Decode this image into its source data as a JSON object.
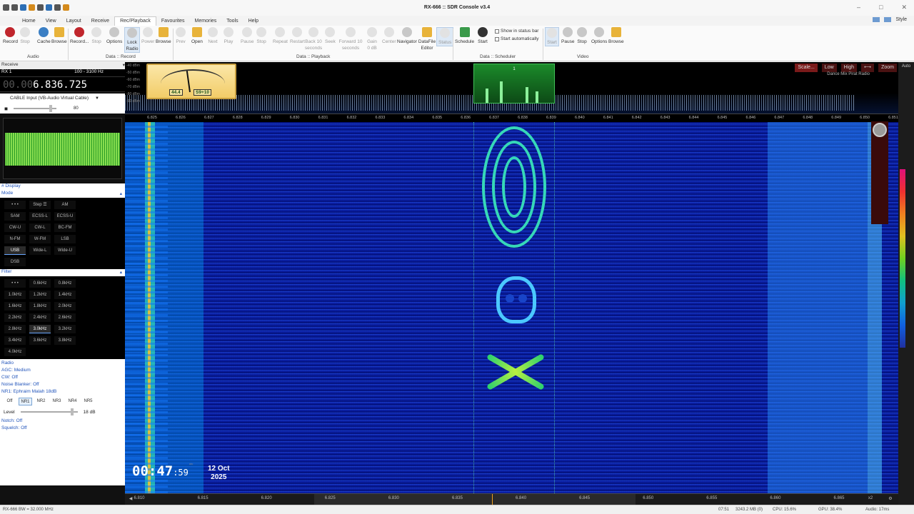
{
  "app": {
    "title": "RX-666 :: SDR Console v3.4",
    "style_label": "Style"
  },
  "menu": [
    "Home",
    "View",
    "Layout",
    "Receive",
    "Rec/Playback",
    "Favourites",
    "Memories",
    "Tools",
    "Help"
  ],
  "menu_active": "Rec/Playback",
  "ribbon": {
    "audio": {
      "group": "Audio",
      "buttons": [
        "Record",
        "Stop",
        "Cache",
        "Browse"
      ]
    },
    "data_record": {
      "group": "Data :: Record",
      "buttons": [
        "Record...",
        "Stop",
        "Options",
        "Lock Radio",
        "Power",
        "Browse"
      ]
    },
    "data_playback": {
      "group": "Data :: Playback",
      "buttons": [
        "Prev",
        "Open",
        "Next",
        "Play",
        "Pause",
        "Stop",
        "Repeat",
        "Restart",
        "Back 10 seconds",
        "Seek",
        "Forward 10 seconds",
        "Gain 0 dB",
        "Center",
        "Navigator",
        "DataFile Editor",
        "Status"
      ]
    },
    "data_scheduler": {
      "group": "Data :: Scheduler",
      "buttons": [
        "Schedule",
        "Start"
      ],
      "checks": [
        "Show in status bar",
        "Start automatically"
      ]
    },
    "video": {
      "group": "Video",
      "buttons": [
        "Start",
        "Pause",
        "Stop",
        "Options",
        "Browse"
      ]
    }
  },
  "left": {
    "receive_header": "Receive",
    "rx_label": "RX 1",
    "bandwidth": "100 - 3100 Hz",
    "freq_dim": "00.00",
    "freq_main": "6.836.725",
    "input_device": "CABLE Input (VB-Audio Virtual Cable)",
    "volume_value": "80",
    "display_label": "# Display",
    "mode_label": "Mode",
    "modes": [
      "• • •",
      "Step ☰",
      "AM",
      "SAM",
      "ECSS-L",
      "ECSS-U",
      "CW-U",
      "CW-L",
      "BC-FM",
      "N-FM",
      "W-FM",
      "LSB",
      "USB",
      "Wide-L",
      "Wide-U",
      "DSB"
    ],
    "mode_selected": "USB",
    "filter_label": "Filter",
    "filters": [
      "• • •",
      "0.6kHz",
      "0.8kHz",
      "1.0kHz",
      "1.2kHz",
      "1.4kHz",
      "1.6kHz",
      "1.8kHz",
      "2.0kHz",
      "2.2kHz",
      "2.4kHz",
      "2.6kHz",
      "2.8kHz",
      "3.0kHz",
      "3.2kHz",
      "3.4kHz",
      "3.6kHz",
      "3.8kHz",
      "4.0kHz"
    ],
    "filter_selected": "3.0kHz",
    "radio_lines": [
      "Radio",
      "AGC: Medium",
      "CW: Off",
      "Noise Blanker: Off",
      "NR1: Ephraim Malah 18dB"
    ],
    "nr_buttons": [
      "Off",
      "NR1",
      "NR2",
      "NR3",
      "NR4",
      "NR5"
    ],
    "nr_selected": "NR1",
    "level_label": "Level",
    "level_value": "18 dB",
    "notch": "Notch: Off",
    "squelch": "Squelch: Off"
  },
  "main": {
    "meter": {
      "reading1": "44.4",
      "reading2": "S9+10"
    },
    "db_labels": [
      "-40 dBm",
      "-50 dBm",
      "-60 dBm",
      "-70 dBm",
      "-80 dBm",
      "-90 dBm"
    ],
    "scheduler_num": "1",
    "controls": [
      "Scale...",
      "Low",
      "High",
      "⟷",
      "Zoom"
    ],
    "auto_label": "Auto",
    "station": "Dance Mix Pirat Radio",
    "top_scale": [
      "6.825",
      "6.826",
      "6.827",
      "6.828",
      "6.829",
      "6.830",
      "6.831",
      "6.832",
      "6.833",
      "6.834",
      "6.835",
      "6.836",
      "6.837",
      "6.838",
      "6.839",
      "6.840",
      "6.841",
      "6.842",
      "6.843",
      "6.844",
      "6.845",
      "6.846",
      "6.847",
      "6.848",
      "6.849",
      "6.850",
      "6.851"
    ],
    "bottom_scale": [
      "6.810",
      "6.815",
      "6.820",
      "6.825",
      "6.830",
      "6.835",
      "6.840",
      "6.845",
      "6.850",
      "6.855",
      "6.860",
      "6.865"
    ],
    "time_hm": "00:47",
    "time_s": ":59",
    "time_utc": "utc",
    "date_line1": "12 Oct",
    "date_line2": "2025",
    "zoom_factor": "x2"
  },
  "status": {
    "left": "RX-666 BW = 32.000 MHz",
    "time": "07:51",
    "disk": "3243.2 MB (0)",
    "cpu": "CPU: 15.6%",
    "gpu": "GPU: 38.4%",
    "audio": "Audio: 17ms"
  }
}
